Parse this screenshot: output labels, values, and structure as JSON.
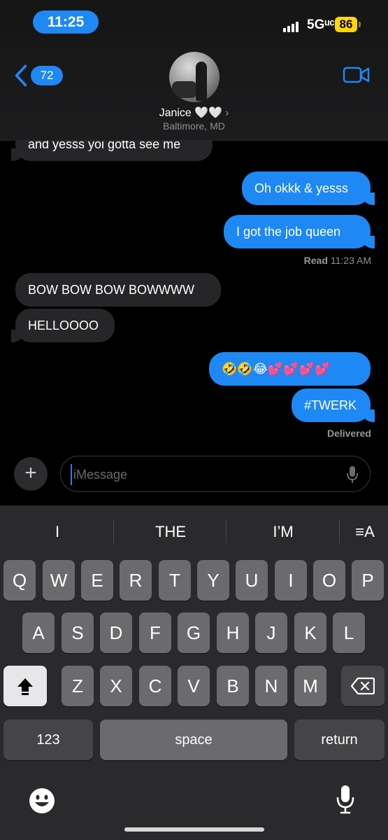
{
  "status_bar": {
    "time": "11:25",
    "network": "5Gᵘᶜ",
    "battery": "86",
    "colors": {
      "time_pill": "#1e88f5",
      "battery": "#ffd60a"
    }
  },
  "header": {
    "back_count": "72",
    "contact_name": "Janice 🤍🤍",
    "contact_chevron": "›",
    "contact_location": "Baltimore, MD"
  },
  "messages": [
    {
      "side": "in",
      "text": "and yesss yoi gotta see me"
    },
    {
      "side": "out",
      "text": "Oh okkk & yesss"
    },
    {
      "side": "out",
      "text": "I got the job queen"
    },
    {
      "side": "in",
      "text": "BOW BOW BOW BOWWWW"
    },
    {
      "side": "in",
      "text": "HELLOOOO"
    },
    {
      "side": "out",
      "text": "🤣🤣😂💕💕💕💕"
    },
    {
      "side": "out",
      "text": "#TWERK"
    }
  ],
  "read_receipt": {
    "label": "Read",
    "time": "11:23 AM"
  },
  "delivered_label": "Delivered",
  "compose": {
    "placeholder": "iMessage",
    "value": ""
  },
  "keyboard": {
    "suggestions": [
      "I",
      "THE",
      "I’M"
    ],
    "format_label": "≡A",
    "row1": [
      "Q",
      "W",
      "E",
      "R",
      "T",
      "Y",
      "U",
      "I",
      "O",
      "P"
    ],
    "row2": [
      "A",
      "S",
      "D",
      "F",
      "G",
      "H",
      "J",
      "K",
      "L"
    ],
    "row3": [
      "Z",
      "X",
      "C",
      "V",
      "B",
      "N",
      "M"
    ],
    "numbers_label": "123",
    "space_label": "space",
    "return_label": "return"
  },
  "icons": [
    "back-chevron-icon",
    "video-camera-icon",
    "plus-icon",
    "microphone-icon",
    "shift-icon",
    "delete-icon",
    "emoji-icon",
    "dictation-icon"
  ]
}
